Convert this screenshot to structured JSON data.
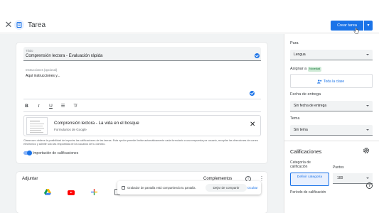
{
  "header": {
    "title": "Tarea",
    "create_label": "Crear tarea",
    "close_icon": "close-icon",
    "doc_icon": "assignment-icon"
  },
  "form": {
    "title_label": "Título",
    "title_value": "Comprensión lectora - Evaluación rápida",
    "instructions_label": "Instrucciones (opcional)",
    "instructions_value": "Aquí instrucciones y...",
    "toolbar": [
      "B",
      "I",
      "U",
      "list-icon",
      "clear-format-icon"
    ],
    "attachment": {
      "title": "Comprensión lectora - La vida en el bosque",
      "subtitle": "Formularios de Google"
    },
    "notice": "Classroom obtiene la posibilidad de importar las calificaciones de las tareas. Esta opción permite limitar automáticamente cada formulario a una respuesta por usuario, recopilar las direcciones de correo electrónico y admitir solo las respuestas de los usuarios de tu dominio.",
    "import_grades_label": "Importación de calificaciones",
    "import_grades_on": true
  },
  "attach_section": {
    "attach_label": "Adjuntar",
    "addons_label": "Complementos",
    "apps": [
      "drive-icon",
      "youtube-icon",
      "create-icon",
      "device-icon"
    ]
  },
  "screen_share": {
    "text": "Grabador de pantalla está compartiendo tu pantalla.",
    "stop_label": "Dejar de compartir",
    "hide_label": "Ocultar"
  },
  "sidebar": {
    "for_label": "Para",
    "for_value": "Lengua",
    "assign_label": "Asignar a",
    "new_badge": "Novedad",
    "assign_value": "Toda la clase",
    "due_label": "Fecha de entrega",
    "due_value": "Sin fecha de entrega",
    "topic_label": "Tema",
    "topic_value": "Sin tema",
    "grades_title": "Calificaciones",
    "grade_category_label": "Categoría de calificación",
    "points_label": "Puntos",
    "define_category_label": "Definir categoría",
    "points_value": "100",
    "grading_period_label": "Período de calificación"
  }
}
